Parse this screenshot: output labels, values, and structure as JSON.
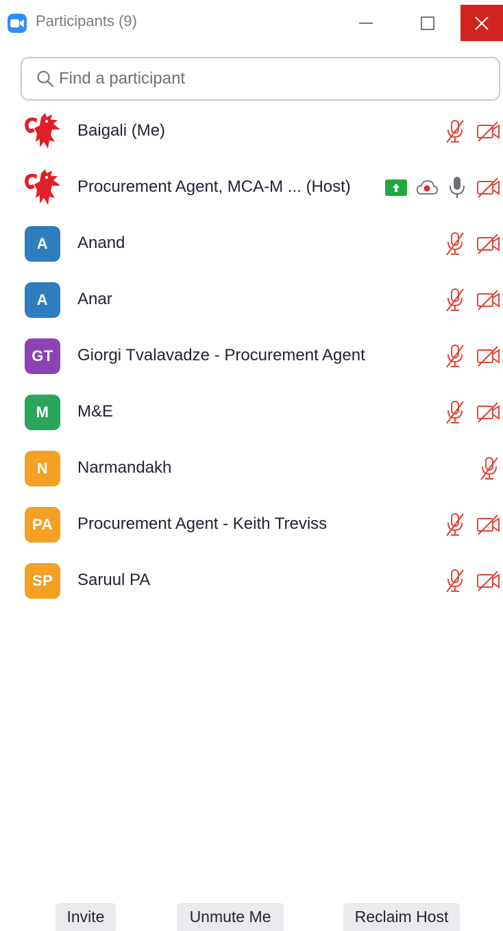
{
  "window": {
    "title": "Participants (9)",
    "app_icon": "zoom-camera-icon"
  },
  "search": {
    "placeholder": "Find a participant",
    "value": ""
  },
  "participants": [
    {
      "name": "Baigali (Me)",
      "avatar_type": "logo",
      "muted": true,
      "video_off": true
    },
    {
      "name": "Procurement Agent, MCA-M ... (Host)",
      "avatar_type": "logo",
      "sharing": true,
      "recording": true,
      "muted": false,
      "video_off": true
    },
    {
      "name": "Anand",
      "initials": "A",
      "avatar_color": "#2e7dbf",
      "muted": true,
      "video_off": true
    },
    {
      "name": "Anar",
      "initials": "A",
      "avatar_color": "#2e7dbf",
      "muted": true,
      "video_off": true
    },
    {
      "name": "Giorgi Tvalavadze - Procurement Agent",
      "initials": "GT",
      "avatar_color": "#8c43b5",
      "muted": true,
      "video_off": true
    },
    {
      "name": "M&E",
      "initials": "M",
      "avatar_color": "#2aa65c",
      "muted": true,
      "video_off": true
    },
    {
      "name": "Narmandakh",
      "initials": "N",
      "avatar_color": "#f4a023",
      "muted": true,
      "video_off": false
    },
    {
      "name": "Procurement Agent - Keith Treviss",
      "initials": "PA",
      "avatar_color": "#f4a023",
      "muted": true,
      "video_off": true
    },
    {
      "name": "Saruul PA",
      "initials": "SP",
      "avatar_color": "#f4a023",
      "muted": true,
      "video_off": true
    }
  ],
  "footer": {
    "invite_label": "Invite",
    "unmute_label": "Unmute Me",
    "reclaim_label": "Reclaim Host"
  },
  "colors": {
    "muted_red": "#e0463c",
    "close_red": "#d0251f",
    "share_green": "#23a740",
    "zoom_blue": "#2d8cff"
  }
}
